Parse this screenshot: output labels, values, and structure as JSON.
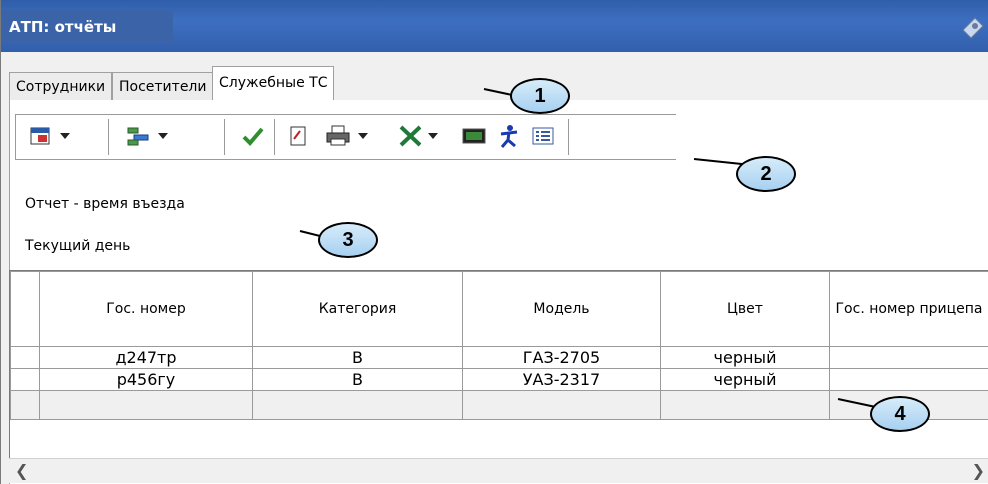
{
  "window": {
    "title": "АТП: отчёты"
  },
  "tabs": [
    {
      "label": "Сотрудники"
    },
    {
      "label": "Посетители"
    },
    {
      "label": "Служебные ТС"
    }
  ],
  "toolbar": {
    "icons": [
      "calendar-icon",
      "layout-icon",
      "checkmark-icon",
      "edit-document-icon",
      "printer-icon",
      "excel-icon",
      "terminal-icon",
      "person-icon",
      "list-view-icon"
    ]
  },
  "report": {
    "title": "Отчет - время въезда",
    "period": "Текущий день"
  },
  "table": {
    "headers": [
      "Гос. номер",
      "Категория",
      "Модель",
      "Цвет",
      "Гос. номер прицепа"
    ],
    "rows": [
      [
        "д247тр",
        "В",
        "ГАЗ-2705",
        "черный",
        ""
      ],
      [
        "р456гу",
        "В",
        "УАЗ-2317",
        "черный",
        ""
      ]
    ]
  },
  "callouts": [
    "1",
    "2",
    "3",
    "4"
  ],
  "colors": {
    "titlebar": "#2f5eaa",
    "callout_fill": "#b8dcf5"
  }
}
